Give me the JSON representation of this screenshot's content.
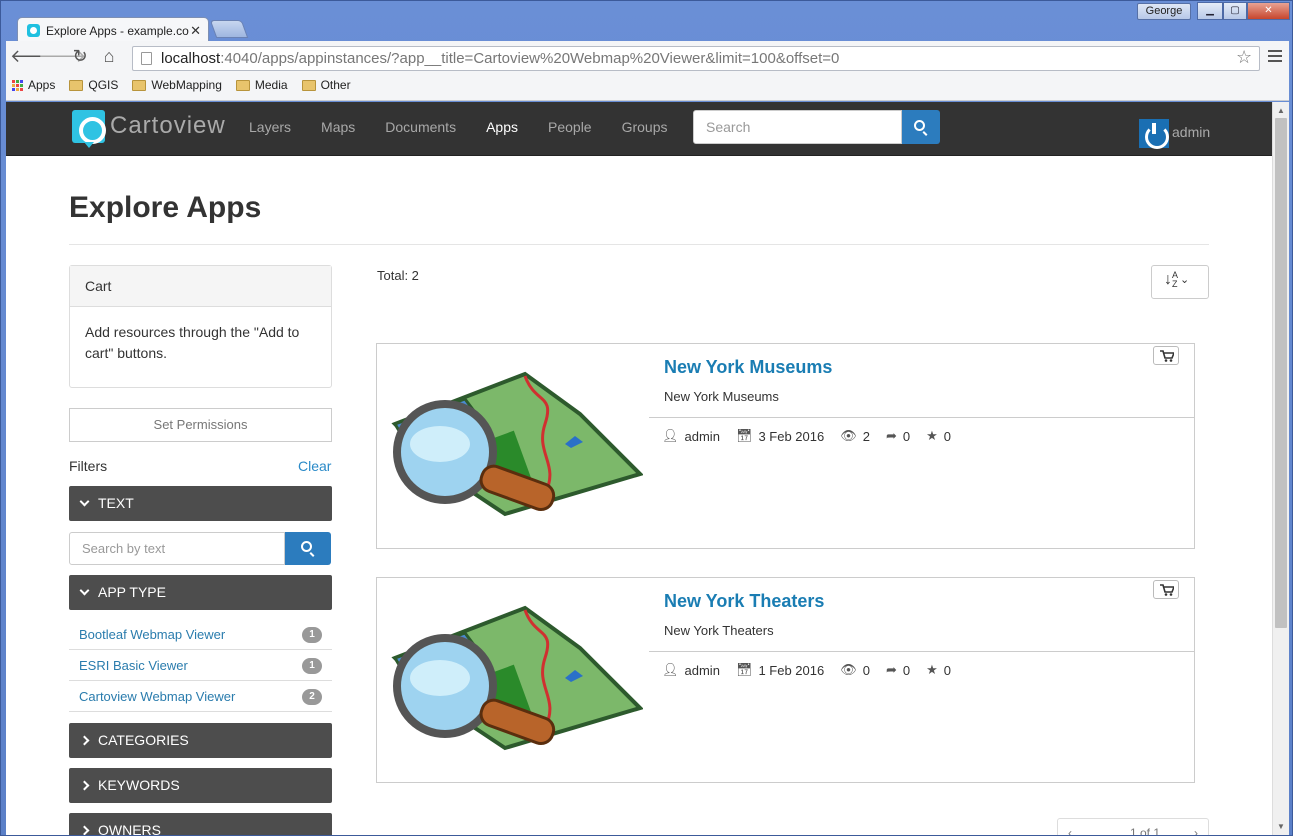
{
  "browser": {
    "tab_title": "Explore Apps - example.co",
    "tab_close": "✕",
    "user": "George",
    "window_buttons": [
      "▁",
      "▢",
      "✕"
    ],
    "url_host": "localhost",
    "url_rest": ":4040/apps/appinstances/?app__title=Cartoview%20Webmap%20Viewer&limit=100&offset=0",
    "nav_icons": [
      "back-arrow-icon",
      "forward-arrow-icon",
      "reload-icon",
      "home-icon"
    ],
    "nav_glyphs": [
      "🡐",
      "🡒",
      "↻",
      "⌂"
    ],
    "star": "☆",
    "bookmarks": [
      "Apps",
      "QGIS",
      "WebMapping",
      "Media",
      "Other"
    ]
  },
  "site": {
    "brand": "Cartoview",
    "nav": [
      "Layers",
      "Maps",
      "Documents",
      "Apps",
      "People",
      "Groups"
    ],
    "active_nav": "Apps",
    "search_placeholder": "Search",
    "user": "admin"
  },
  "page": {
    "title": "Explore Apps",
    "cart_title": "Cart",
    "cart_body": "Add resources through the \"Add to cart\" buttons.",
    "set_permissions": "Set Permissions",
    "filters_label": "Filters",
    "clear_label": "Clear",
    "facet_text": "TEXT",
    "text_search_placeholder": "Search by text",
    "facet_app_type": "APP TYPE",
    "app_types": [
      {
        "label": "Bootleaf Webmap Viewer",
        "count": "1"
      },
      {
        "label": "ESRI Basic Viewer",
        "count": "1"
      },
      {
        "label": "Cartoview Webmap Viewer",
        "count": "2"
      }
    ],
    "facet_categories": "CATEGORIES",
    "facet_keywords": "KEYWORDS",
    "facet_owners": "OWNERS",
    "total": "Total: 2",
    "sort_label": "AZ",
    "results": [
      {
        "title": "New York Museums",
        "description": "New York Museums",
        "owner": "admin",
        "date": "3 Feb 2016",
        "views": "2",
        "shares": "0",
        "rating": "0"
      },
      {
        "title": "New York Theaters",
        "description": "New York Theaters",
        "owner": "admin",
        "date": "1 Feb 2016",
        "views": "0",
        "shares": "0",
        "rating": "0"
      }
    ],
    "pagination": "1 of 1"
  },
  "colors": {
    "navbar": "#333333",
    "accent": "#2c7cbe",
    "link": "#1a7db3",
    "facet": "#4d4d4d",
    "brand_icon": "#2fc3e3"
  }
}
